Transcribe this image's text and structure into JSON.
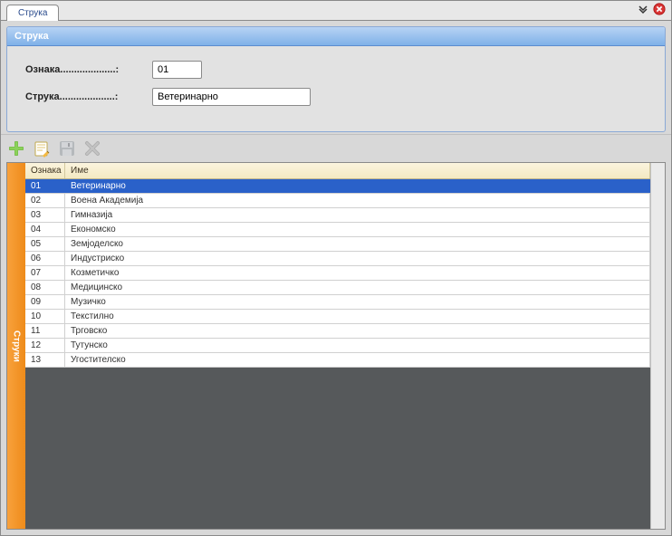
{
  "tab": {
    "label": "Струка"
  },
  "panel": {
    "title": "Струка"
  },
  "form": {
    "label_code": "Ознака....................:",
    "label_name": "Струка....................:",
    "value_code": "01",
    "value_name": "Ветеринарно"
  },
  "toolbar": {
    "add": "add",
    "edit": "edit",
    "save": "save",
    "delete": "delete"
  },
  "grid": {
    "sidebar_label": "Струки",
    "header_code": "Ознака",
    "header_name": "Име",
    "selected_index": 0,
    "rows": [
      {
        "code": "01",
        "name": "Ветеринарно"
      },
      {
        "code": "02",
        "name": "Воена Академија"
      },
      {
        "code": "03",
        "name": "Гимназија"
      },
      {
        "code": "04",
        "name": "Економско"
      },
      {
        "code": "05",
        "name": "Земјоделско"
      },
      {
        "code": "06",
        "name": "Индустриско"
      },
      {
        "code": "07",
        "name": "Козметичко"
      },
      {
        "code": "08",
        "name": "Медицинско"
      },
      {
        "code": "09",
        "name": "Музичко"
      },
      {
        "code": "10",
        "name": "Текстилно"
      },
      {
        "code": "11",
        "name": "Трговско"
      },
      {
        "code": "12",
        "name": "Тутунско"
      },
      {
        "code": "13",
        "name": "Угостителско"
      }
    ]
  }
}
